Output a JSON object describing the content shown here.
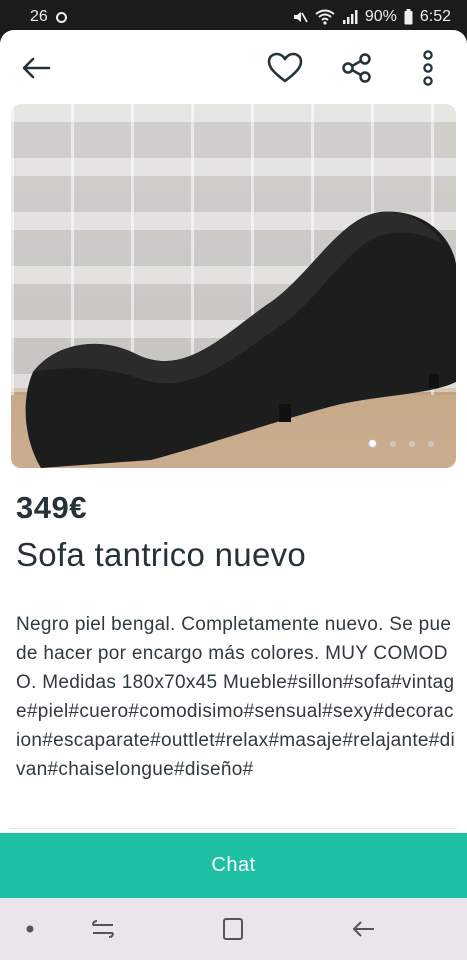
{
  "status_bar": {
    "time_left": "26",
    "battery": "90%",
    "clock": "6:52"
  },
  "toolbar": {
    "back_icon": "arrow-left-icon",
    "favorite_icon": "heart-icon",
    "share_icon": "share-icon",
    "menu_icon": "more-vert-icon"
  },
  "gallery": {
    "image_description_icon": "sofa-photo",
    "page_count": 4,
    "active_page": 1
  },
  "listing": {
    "price": "349€",
    "title": "Sofa tantrico nuevo",
    "description": "Negro piel bengal. Completamente nuevo. Se puede hacer por encargo más colores. MUY COMODO. Medidas 180x70x45 Mueble#sillon#sofa#vintage#piel#cuero#comodisimo#sensual#sexy#decoracion#escaparate#outtlet#relax#masaje#relajante#divan#chaiselongue#diseño#"
  },
  "actions": {
    "chat_label": "Chat"
  },
  "colors": {
    "accent": "#1ec1a4",
    "text": "#253238",
    "nav_bg": "#ece4ec"
  }
}
